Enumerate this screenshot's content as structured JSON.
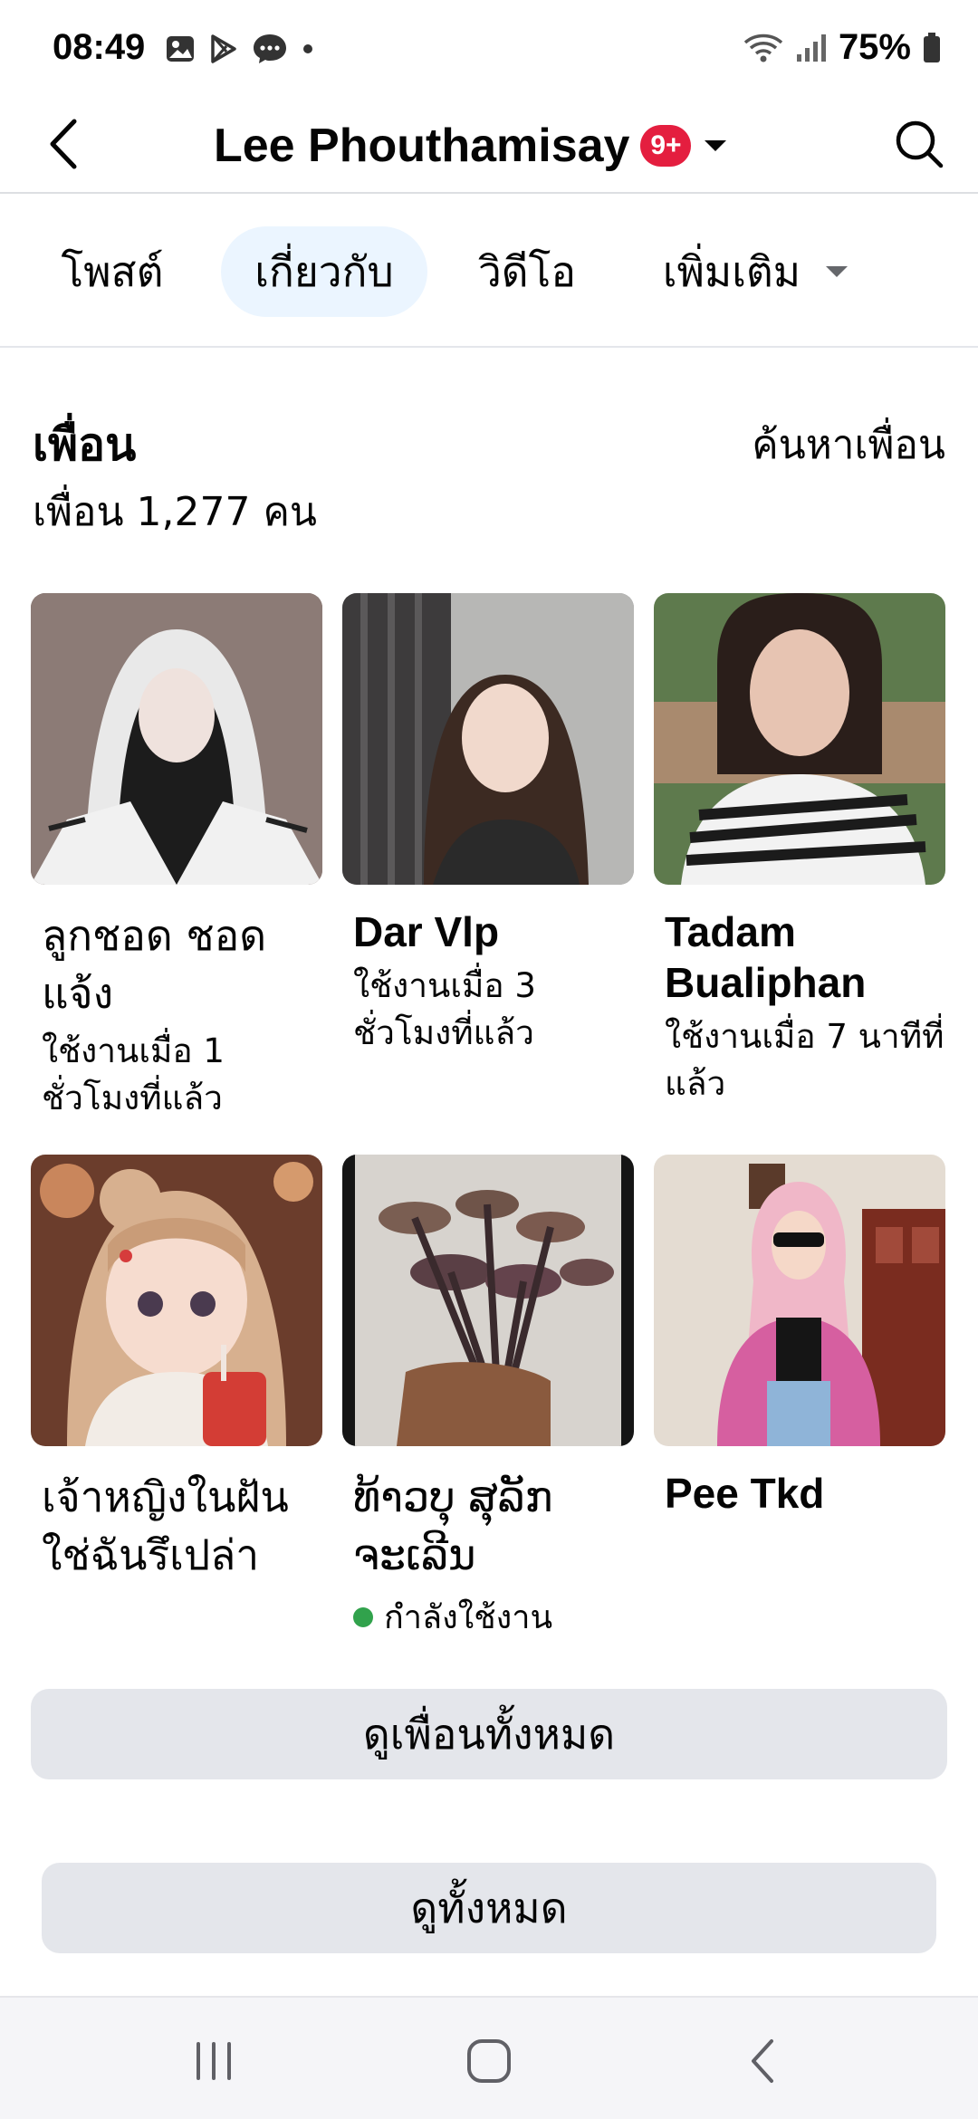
{
  "status_bar": {
    "time": "08:49",
    "battery": "75%",
    "left_icons": [
      "gallery-icon",
      "play-store-icon",
      "messenger-icon",
      "dot-icon"
    ],
    "right_icons": [
      "wifi-icon",
      "signal-icon",
      "battery-icon"
    ]
  },
  "header": {
    "title": "Lee Phouthamisay",
    "badge": "9+"
  },
  "tabs": [
    {
      "label": "โพสต์",
      "active": false
    },
    {
      "label": "เกี่ยวกับ",
      "active": true
    },
    {
      "label": "วิดีโอ",
      "active": false
    },
    {
      "label": "เพิ่มเติม",
      "active": false
    }
  ],
  "friends": {
    "heading": "เพื่อน",
    "count": "เพื่อน 1,277 คน",
    "find_link": "ค้นหาเพื่อน",
    "list": [
      {
        "name": "ลูกชอด ชอด แจ้ง",
        "status": "ใช้งานเมื่อ 1 ชั่วโมงที่แล้ว"
      },
      {
        "name": "Dar Vlp",
        "status": "ใช้งานเมื่อ 3 ชั่วโมงที่แล้ว"
      },
      {
        "name": "Tadam Bualiphan",
        "status": "ใช้งานเมื่อ 7 นาทีที่แล้ว"
      },
      {
        "name": "เจ้าหญิงในฝัน ใช่ฉันรึเปล่า",
        "status": ""
      },
      {
        "name": "ທ້າວບຸ ສຸລັກ ຈະເລີນ",
        "status": "กำลังใช้งาน"
      },
      {
        "name": "Pee Tkd",
        "status": ""
      }
    ],
    "see_all_friends": "ดูเพื่อนทั้งหมด"
  },
  "see_all": "ดูทั้งหมด",
  "colors": {
    "tab_active_bg": "#ebf5ff",
    "button_bg": "#e4e6eb",
    "badge": "#e41e3f",
    "online": "#31a24c"
  }
}
